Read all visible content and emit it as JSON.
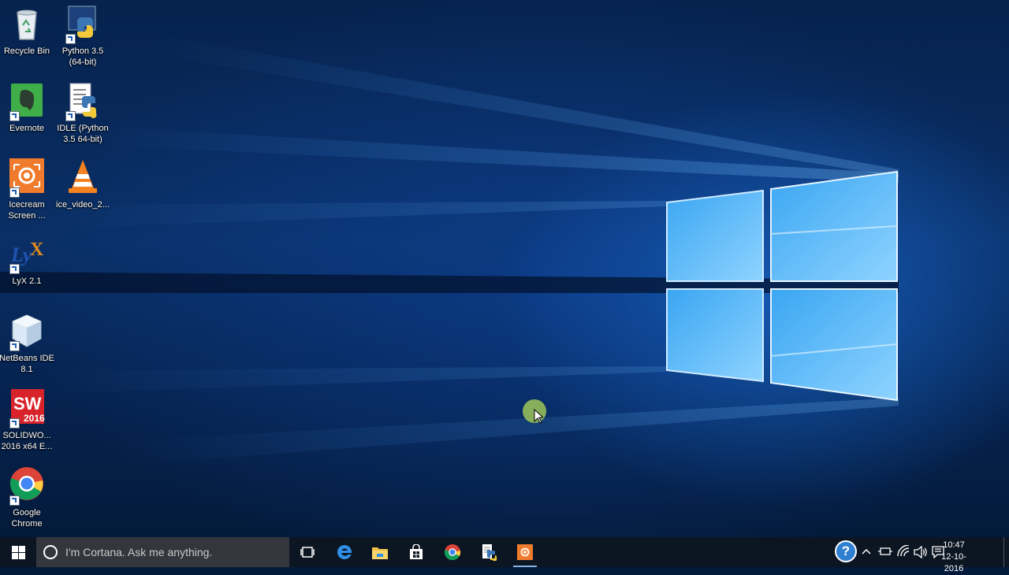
{
  "desktop": {
    "icons": [
      {
        "label": "Recycle Bin",
        "icon": "recycle-bin-icon"
      },
      {
        "label": "Python 3.5 (64-bit)",
        "icon": "python-icon"
      },
      {
        "label": "Evernote",
        "icon": "evernote-icon"
      },
      {
        "label": "IDLE (Python 3.5 64-bit)",
        "icon": "idle-python-icon"
      },
      {
        "label": "Icecream Screen ...",
        "icon": "icecream-icon"
      },
      {
        "label": "ice_video_2...",
        "icon": "vlc-icon"
      },
      {
        "label": "LyX 2.1",
        "icon": "lyx-icon"
      },
      {
        "label": "NetBeans IDE 8.1",
        "icon": "netbeans-icon"
      },
      {
        "label": "SOLIDWO... 2016 x64 E...",
        "icon": "solidworks-icon"
      },
      {
        "label": "Google Chrome",
        "icon": "chrome-icon"
      }
    ],
    "solidworks_badge": {
      "top": "SW",
      "year": "2016"
    },
    "lyx_badge": "LyX"
  },
  "taskbar": {
    "search_placeholder": "I'm Cortana. Ask me anything.",
    "pinned": [
      "task-view",
      "edge",
      "file-explorer",
      "store",
      "chrome",
      "idle-python",
      "icecream-recorder"
    ],
    "active_app": "icecream-recorder",
    "help_label": "?",
    "time": "10:47",
    "date": "12-10-2016"
  },
  "colors": {
    "taskbar": "#0c1522",
    "search_box": "#33373d",
    "accent": "#2f7fd1"
  }
}
